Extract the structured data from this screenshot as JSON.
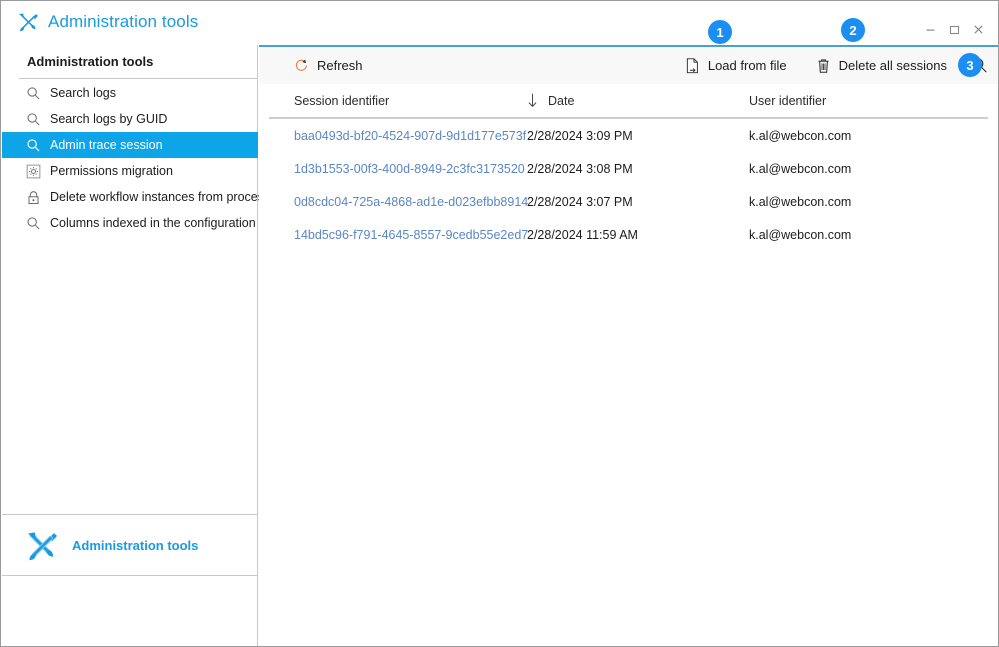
{
  "window": {
    "title": "Administration tools",
    "title_icon": "tools-icon",
    "controls": [
      {
        "name": "minimize-button",
        "icon": "minimize-icon"
      },
      {
        "name": "maximize-button",
        "icon": "maximize-icon"
      },
      {
        "name": "close-button",
        "icon": "close-icon"
      }
    ],
    "accent_color": "#1a9ae0",
    "selection_color": "#0ea5e8",
    "link_color": "#5b86c4",
    "badge_color": "#1b8ef2"
  },
  "sidebar": {
    "header": "Administration tools",
    "items": [
      {
        "label": "Search logs",
        "icon": "search-icon",
        "selected": false
      },
      {
        "label": "Search logs by GUID",
        "icon": "search-icon",
        "selected": false
      },
      {
        "label": "Admin trace session",
        "icon": "search-icon",
        "selected": true
      },
      {
        "label": "Permissions migration",
        "icon": "gear-icon",
        "selected": false
      },
      {
        "label": "Delete workflow instances from process",
        "icon": "lock-icon",
        "selected": false
      },
      {
        "label": "Columns indexed in the configuration",
        "icon": "search-icon",
        "selected": false
      }
    ],
    "footer": {
      "label": "Administration tools",
      "icon": "tools-icon"
    }
  },
  "toolbar": {
    "refresh_label": "Refresh",
    "refresh_icon": "refresh-icon",
    "load_from_file_label": "Load from file",
    "load_from_file_icon": "file-import-icon",
    "delete_all_sessions_label": "Delete all sessions",
    "delete_all_sessions_icon": "trash-icon",
    "search_icon": "search-icon"
  },
  "table": {
    "columns": [
      {
        "key": "session",
        "label": "Session identifier",
        "sorted": false
      },
      {
        "key": "date",
        "label": "Date",
        "sorted": true,
        "sort_direction": "descending",
        "sort_icon": "arrow-down-icon"
      },
      {
        "key": "user",
        "label": "User identifier",
        "sorted": false
      }
    ],
    "rows": [
      {
        "session": "baa0493d-bf20-4524-907d-9d1d177e573f",
        "date": "2/28/2024 3:09 PM",
        "user": "k.al@webcon.com"
      },
      {
        "session": "1d3b1553-00f3-400d-8949-2c3fc3173520",
        "date": "2/28/2024 3:08 PM",
        "user": "k.al@webcon.com"
      },
      {
        "session": "0d8cdc04-725a-4868-ad1e-d023efbb8914",
        "date": "2/28/2024 3:07 PM",
        "user": "k.al@webcon.com"
      },
      {
        "session": "14bd5c96-f791-4645-8557-9cedb55e2ed7",
        "date": "2/28/2024 11:59 AM",
        "user": "k.al@webcon.com"
      }
    ]
  },
  "callouts": [
    {
      "id": "1",
      "label": "1"
    },
    {
      "id": "2",
      "label": "2"
    },
    {
      "id": "3",
      "label": "3"
    }
  ]
}
